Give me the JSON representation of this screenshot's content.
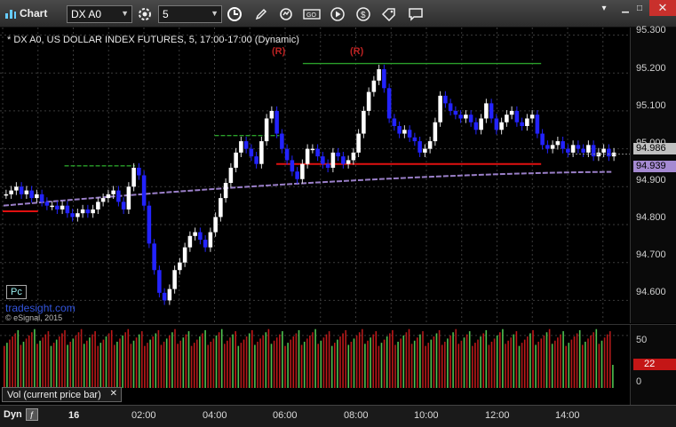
{
  "window": {
    "title": "Chart",
    "symbol": "DX A0",
    "interval": "5",
    "icons": [
      "clock-icon",
      "pencil-icon",
      "refresh-icon",
      "chart-type-icon",
      "play-icon",
      "dollar-icon",
      "tag-icon",
      "comment-icon"
    ]
  },
  "chart": {
    "title": "* DX A0, US DOLLAR INDEX FUTURES, 5, 17:00-17:00 (Dynamic)",
    "brand": "tradesight.com",
    "copyright": "© eSignal, 2015",
    "badge": "Pc",
    "r_markers": [
      "(R)",
      "(R)"
    ],
    "price_ticks": [
      "95.300",
      "95.200",
      "95.100",
      "95.000",
      "94.900",
      "94.800",
      "94.700",
      "94.600"
    ],
    "last_price_label": "94.986",
    "avg_price_label": "94.939",
    "colors": {
      "up_bar": "#ffffff",
      "down_bar": "#2323ff",
      "ma_line": "#9a7fc8",
      "support_red": "#e01010",
      "resist_green": "#2aa02a",
      "last_price_bg": "#c0c0c0",
      "avg_price_bg": "#a58ad2"
    }
  },
  "volume": {
    "tab_label": "Vol (current price bar)",
    "ticks": [
      "50",
      "0"
    ],
    "current_label": "22"
  },
  "time_axis": {
    "dyn_label": "Dyn",
    "day_label": "16",
    "ticks": [
      "02:00",
      "04:00",
      "06:00",
      "08:00",
      "10:00",
      "12:00",
      "14:00"
    ]
  },
  "chart_data": {
    "type": "candlestick",
    "title": "* DX A0, US DOLLAR INDEX FUTURES, 5, 17:00-17:00 (Dynamic)",
    "xlabel": "",
    "ylabel": "",
    "ylim": [
      94.54,
      95.32
    ],
    "x_ticks": [
      "02:00",
      "04:00",
      "06:00",
      "08:00",
      "10:00",
      "12:00",
      "14:00"
    ],
    "y_ticks": [
      95.3,
      95.2,
      95.1,
      95.0,
      94.9,
      94.8,
      94.7,
      94.6
    ],
    "close_series": [
      94.88,
      94.89,
      94.9,
      94.88,
      94.89,
      94.87,
      94.88,
      94.86,
      94.85,
      94.85,
      94.84,
      94.85,
      94.83,
      94.82,
      94.83,
      94.84,
      94.83,
      94.84,
      94.86,
      94.87,
      94.88,
      94.89,
      94.86,
      94.84,
      94.9,
      94.95,
      94.93,
      94.85,
      94.75,
      94.68,
      94.62,
      94.6,
      94.63,
      94.68,
      94.7,
      94.74,
      94.77,
      94.78,
      94.76,
      94.74,
      94.78,
      94.82,
      94.87,
      94.91,
      94.95,
      94.99,
      95.02,
      95.0,
      94.98,
      94.96,
      95.02,
      95.08,
      95.1,
      95.04,
      95.0,
      94.97,
      94.94,
      94.92,
      94.96,
      95.0,
      95.0,
      94.98,
      94.96,
      94.95,
      94.99,
      94.98,
      94.96,
      94.97,
      94.99,
      95.04,
      95.1,
      95.15,
      95.18,
      95.21,
      95.16,
      95.08,
      95.06,
      95.04,
      95.05,
      95.03,
      95.02,
      94.99,
      95.0,
      95.02,
      95.07,
      95.14,
      95.12,
      95.1,
      95.09,
      95.08,
      95.09,
      95.07,
      95.05,
      95.08,
      95.12,
      95.08,
      95.05,
      95.07,
      95.09,
      95.1,
      95.07,
      95.06,
      95.08,
      95.09,
      95.04,
      95.01,
      95.0,
      95.01,
      95.02,
      95.0,
      94.99,
      95.01,
      95.0,
      94.99,
      95.01,
      94.98,
      94.99,
      95.0,
      94.98,
      94.99
    ],
    "resistance_green": [
      {
        "x": [
          "01:45",
          "03:45"
        ],
        "y": 94.955
      },
      {
        "x": [
          "06:00",
          "07:50"
        ],
        "y": 95.035
      },
      {
        "x": [
          "08:30",
          "15:15"
        ],
        "y": 95.225
      }
    ],
    "support_red": [
      {
        "x": [
          "00:00",
          "01:00"
        ],
        "y": 94.835
      },
      {
        "x": [
          "07:45",
          "15:15"
        ],
        "y": 94.96
      }
    ],
    "moving_average": {
      "name": "",
      "start": 94.85,
      "end": 94.939
    },
    "last_price": 94.986,
    "avg_price": 94.939,
    "volume_current": 22,
    "volume_ylim": [
      0,
      60
    ]
  }
}
